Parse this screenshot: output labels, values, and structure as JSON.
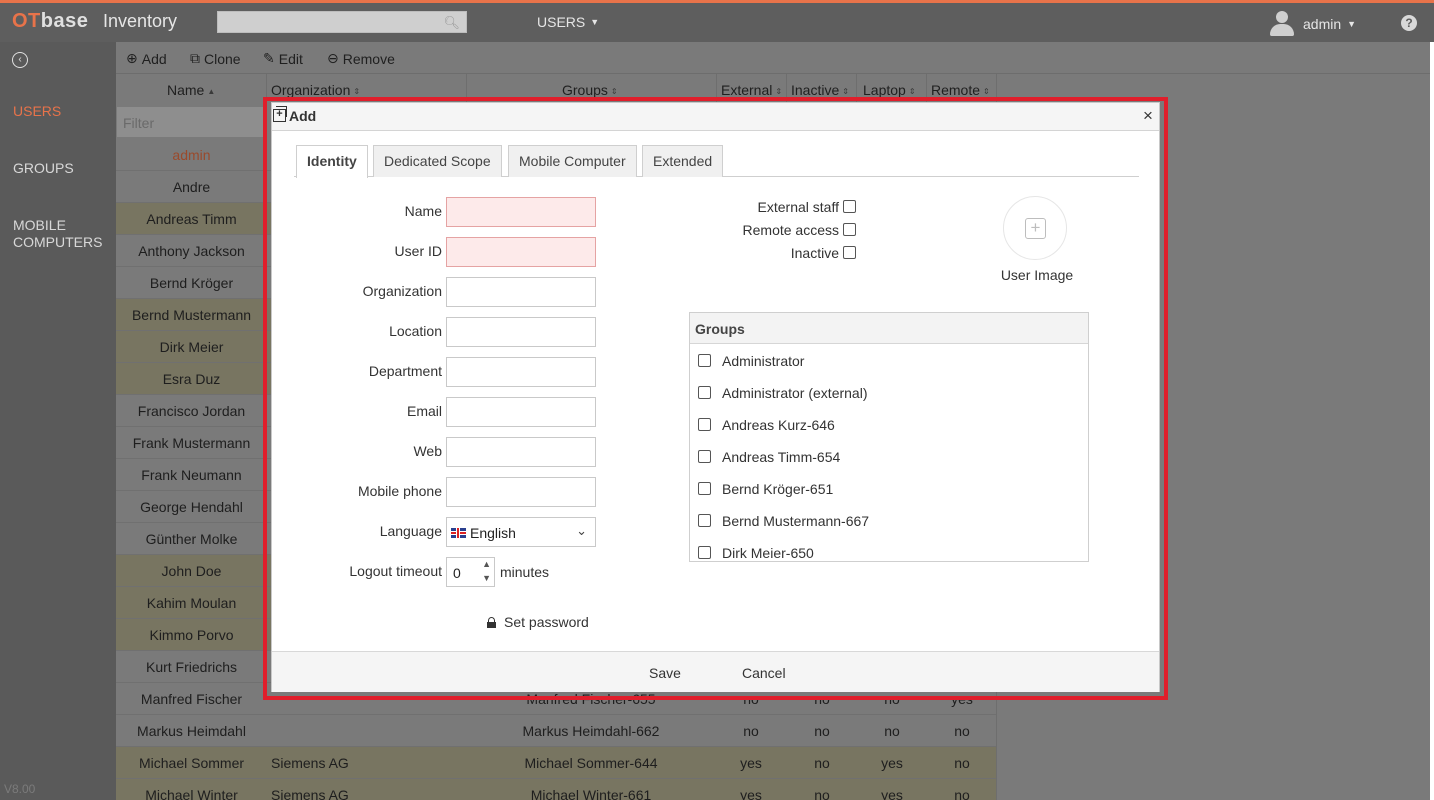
{
  "app": {
    "brand_ot": "OT",
    "brand_base": "base",
    "title": "Inventory",
    "module": "USERS",
    "user": "admin",
    "version": "V8.00"
  },
  "sidebar": {
    "items": [
      "USERS",
      "GROUPS",
      "MOBILE\nCOMPUTERS"
    ]
  },
  "toolbar": {
    "add": "Add",
    "clone": "Clone",
    "edit": "Edit",
    "remove": "Remove"
  },
  "table": {
    "headers": {
      "name": "Name",
      "organization": "Organization",
      "groups": "Groups",
      "external": "External",
      "inactive": "Inactive",
      "laptop": "Laptop",
      "remote": "Remote"
    },
    "filter_placeholder": "Filter",
    "rows": [
      {
        "name": "admin",
        "org": "",
        "groups": "",
        "ext": "",
        "ina": "",
        "lap": "",
        "rem": ""
      },
      {
        "name": "Andre",
        "org": "",
        "groups": "",
        "ext": "",
        "ina": "",
        "lap": "",
        "rem": ""
      },
      {
        "name": "Andreas Timm",
        "org": "",
        "groups": "",
        "ext": "",
        "ina": "",
        "lap": "",
        "rem": ""
      },
      {
        "name": "Anthony Jackson",
        "org": "",
        "groups": "",
        "ext": "",
        "ina": "",
        "lap": "",
        "rem": ""
      },
      {
        "name": "Bernd Kröger",
        "org": "",
        "groups": "",
        "ext": "",
        "ina": "",
        "lap": "",
        "rem": ""
      },
      {
        "name": "Bernd Mustermann",
        "org": "",
        "groups": "",
        "ext": "",
        "ina": "",
        "lap": "",
        "rem": ""
      },
      {
        "name": "Dirk Meier",
        "org": "",
        "groups": "",
        "ext": "",
        "ina": "",
        "lap": "",
        "rem": ""
      },
      {
        "name": "Esra Duz",
        "org": "",
        "groups": "",
        "ext": "",
        "ina": "",
        "lap": "",
        "rem": ""
      },
      {
        "name": "Francisco Jordan",
        "org": "",
        "groups": "",
        "ext": "",
        "ina": "",
        "lap": "",
        "rem": ""
      },
      {
        "name": "Frank Mustermann",
        "org": "",
        "groups": "",
        "ext": "",
        "ina": "",
        "lap": "",
        "rem": ""
      },
      {
        "name": "Frank Neumann",
        "org": "",
        "groups": "",
        "ext": "",
        "ina": "",
        "lap": "",
        "rem": ""
      },
      {
        "name": "George Hendahl",
        "org": "",
        "groups": "",
        "ext": "",
        "ina": "",
        "lap": "",
        "rem": ""
      },
      {
        "name": "Günther Molke",
        "org": "",
        "groups": "",
        "ext": "",
        "ina": "",
        "lap": "",
        "rem": ""
      },
      {
        "name": "John Doe",
        "org": "",
        "groups": "",
        "ext": "",
        "ina": "",
        "lap": "",
        "rem": ""
      },
      {
        "name": "Kahim Moulan",
        "org": "",
        "groups": "",
        "ext": "",
        "ina": "",
        "lap": "",
        "rem": ""
      },
      {
        "name": "Kimmo Porvo",
        "org": "",
        "groups": "",
        "ext": "",
        "ina": "",
        "lap": "",
        "rem": ""
      },
      {
        "name": "Kurt Friedrichs",
        "org": "",
        "groups": "",
        "ext": "",
        "ina": "",
        "lap": "",
        "rem": ""
      },
      {
        "name": "Manfred Fischer",
        "org": "",
        "groups": "Manfred Fischer-655",
        "ext": "no",
        "ina": "no",
        "lap": "no",
        "rem": "yes"
      },
      {
        "name": "Markus Heimdahl",
        "org": "",
        "groups": "Markus Heimdahl-662",
        "ext": "no",
        "ina": "no",
        "lap": "no",
        "rem": "no"
      },
      {
        "name": "Michael Sommer",
        "org": "Siemens AG",
        "groups": "Michael Sommer-644",
        "ext": "yes",
        "ina": "no",
        "lap": "yes",
        "rem": "no"
      },
      {
        "name": "Michael Winter",
        "org": "Siemens AG",
        "groups": "Michael Winter-661",
        "ext": "yes",
        "ina": "no",
        "lap": "yes",
        "rem": "no"
      }
    ]
  },
  "dialog": {
    "title": "Add",
    "tabs": [
      "Identity",
      "Dedicated Scope",
      "Mobile Computer",
      "Extended"
    ],
    "fields": {
      "name": {
        "label": "Name",
        "value": ""
      },
      "user_id": {
        "label": "User ID",
        "value": ""
      },
      "organization": {
        "label": "Organization",
        "value": ""
      },
      "location": {
        "label": "Location",
        "value": ""
      },
      "department": {
        "label": "Department",
        "value": ""
      },
      "email": {
        "label": "Email",
        "value": ""
      },
      "web": {
        "label": "Web",
        "value": ""
      },
      "mobile_phone": {
        "label": "Mobile phone",
        "value": ""
      },
      "language": {
        "label": "Language",
        "value": "English"
      },
      "logout_timeout": {
        "label": "Logout timeout",
        "value": "0",
        "unit": "minutes"
      }
    },
    "set_password": "Set password",
    "checkboxes": {
      "external_staff": {
        "label": "External staff",
        "checked": false
      },
      "remote_access": {
        "label": "Remote access",
        "checked": false
      },
      "inactive": {
        "label": "Inactive",
        "checked": false
      }
    },
    "user_image_label": "User Image",
    "groups_title": "Groups",
    "groups": [
      "Administrator",
      "Administrator (external)",
      "Andreas Kurz-646",
      "Andreas Timm-654",
      "Bernd Kröger-651",
      "Bernd Mustermann-667",
      "Dirk Meier-650"
    ],
    "save": "Save",
    "cancel": "Cancel"
  },
  "colors": {
    "accent": "#e8734a",
    "focus_frame": "#e01e2b",
    "required_bg": "#fdeaea"
  }
}
